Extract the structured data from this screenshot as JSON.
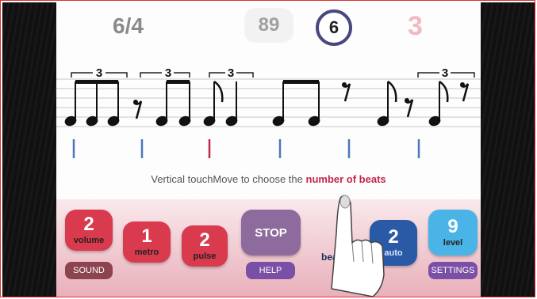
{
  "header": {
    "time_signature": "6/4",
    "tempo": "89",
    "beats": "6",
    "counter": "3"
  },
  "notation": {
    "triplet_label": "3",
    "beat_markers": 6,
    "active_marker_index": 2
  },
  "instruction": {
    "prefix": "Vertical touchMove to choose the ",
    "highlight": "number of beats"
  },
  "controls": {
    "volume": {
      "value": "2",
      "label": "volume"
    },
    "metro": {
      "value": "1",
      "label": "metro"
    },
    "pulse": {
      "value": "2",
      "label": "pulse"
    },
    "stop": {
      "label": "STOP"
    },
    "beat": {
      "label": "beat"
    },
    "auto": {
      "value": "2",
      "label": "auto"
    },
    "level": {
      "value": "9",
      "label": "level"
    },
    "sound": {
      "label": "SOUND"
    },
    "help": {
      "label": "HELP"
    },
    "settings": {
      "label": "SETTINGS"
    }
  },
  "colors": {
    "accent_red": "#d93a4e",
    "stop_purple": "#8e6b9d",
    "auto_blue": "#2a5aa6",
    "level_cyan": "#4bb4e6",
    "beat_marker_blue": "#4a78b9",
    "beat_marker_active": "#c2264a"
  }
}
